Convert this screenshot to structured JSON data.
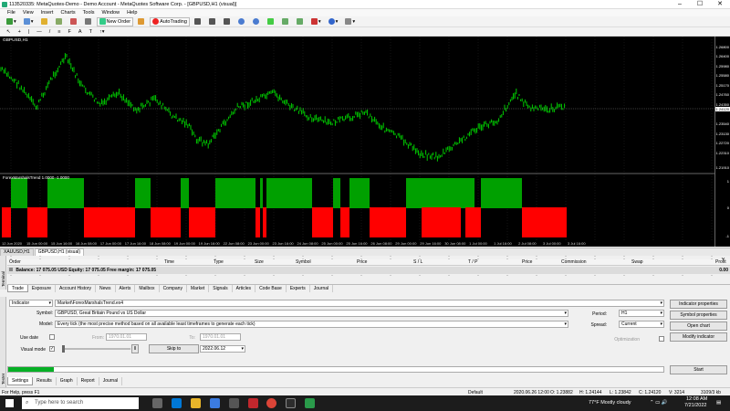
{
  "window": {
    "title": "113520335: MetaQuotes-Demo - Demo Account - MetaQuotes Software Corp. - [GBPUSD,H1 (visual)]",
    "min": "–",
    "max": "☐",
    "close": "✕"
  },
  "menu": [
    "File",
    "View",
    "Insert",
    "Charts",
    "Tools",
    "Window",
    "Help"
  ],
  "toolbar": {
    "new_order": "New Order",
    "auto_trading": "AutoTrading"
  },
  "chart": {
    "label": "GBPUSD,H1",
    "indicator_label": "ForexMarshalsTrend 1.0000 -1.0000",
    "prices": [
      "1.26800",
      "1.26400",
      "1.25980",
      "1.25580",
      "1.25170",
      "1.24760",
      "1.24350",
      "1.23950",
      "1.23540",
      "1.23130",
      "1.22720",
      "1.22310",
      "1.21910"
    ],
    "current_price": "1.24120",
    "ind_levels": [
      "1",
      "0",
      "-1"
    ],
    "time_labels": [
      "12 Jun 2020",
      "15 Jun 00:00",
      "15 Jun 16:00",
      "16 Jun 08:00",
      "17 Jun 00:00",
      "17 Jun 16:00",
      "18 Jun 08:00",
      "19 Jun 00:00",
      "19 Jun 16:00",
      "22 Jun 08:00",
      "23 Jun 00:00",
      "23 Jun 16:00",
      "24 Jun 08:00",
      "25 Jun 00:00",
      "25 Jun 16:00",
      "26 Jun 08:00",
      "29 Jun 00:00",
      "29 Jun 16:00",
      "30 Jun 08:00",
      "1 Jul 00:00",
      "1 Jul 16:00",
      "2 Jul 08:00",
      "3 Jul 00:00",
      "3 Jul 16:00"
    ],
    "colors": {
      "bull": "#00a000",
      "bear": "#ff0000",
      "line": "#00cc00",
      "background": "#000000"
    }
  },
  "chart_tabs": [
    "XAUUSD,H1",
    "GBPUSD,H1 (visual)"
  ],
  "terminal": {
    "columns": [
      "Order",
      "Time",
      "Type",
      "Size",
      "Symbol",
      "Price",
      "S / L",
      "T / P",
      "Price",
      "Commission",
      "Swap",
      "Profit"
    ],
    "balance": "Balance: 17 075.05 USD  Equity: 17 075.05  Free margin: 17 075.05",
    "profit": "0.00",
    "tabs": [
      "Trade",
      "Exposure",
      "Account History",
      "News",
      "Alerts",
      "Mailbox",
      "Company",
      "Market",
      "Signals",
      "Articles",
      "Code Base",
      "Experts",
      "Journal"
    ],
    "sidebar_label": "Terminal"
  },
  "tester": {
    "sidebar_label": "Tester",
    "type": "Indicator",
    "path": "Market\\ForexMarshalsTrend.ex4",
    "symbol_label": "Symbol:",
    "symbol": "GBPUSD, Great Britain Pound vs US Dollar",
    "model_label": "Model:",
    "model": "Every tick (the most precise method based on all available least timeframes to generate each tick)",
    "use_date_label": "Use date",
    "from_label": "From:",
    "from": "1970.01.01",
    "to_label": "To:",
    "to": "1970.01.01",
    "visual_label": "Visual mode",
    "pause": "II",
    "skip_to": "Skip to",
    "skip_date": "2022.06.12",
    "period_label": "Period:",
    "period": "H1",
    "spread_label": "Spread:",
    "spread": "Current",
    "optimization_label": "Optimization",
    "buttons": [
      "Indicator properties",
      "Symbol properties",
      "Open chart",
      "Modify indicator"
    ],
    "start": "Start",
    "progress_percent": 7,
    "tabs": [
      "Settings",
      "Results",
      "Graph",
      "Report",
      "Journal"
    ]
  },
  "status": {
    "help": "For Help, press F1",
    "profile": "Default",
    "datetime": "2020.06.26 12:00",
    "open": "O: 1.23882",
    "high": "H: 1.24144",
    "low": "L: 1.23842",
    "close": "C: 1.24120",
    "volume": "V: 3214",
    "traffic": "3109/3 kb"
  },
  "taskbar": {
    "search": "Type here to search",
    "weather": "77°F  Mostly cloudy",
    "time": "12:08 AM",
    "date": "7/21/2022"
  }
}
